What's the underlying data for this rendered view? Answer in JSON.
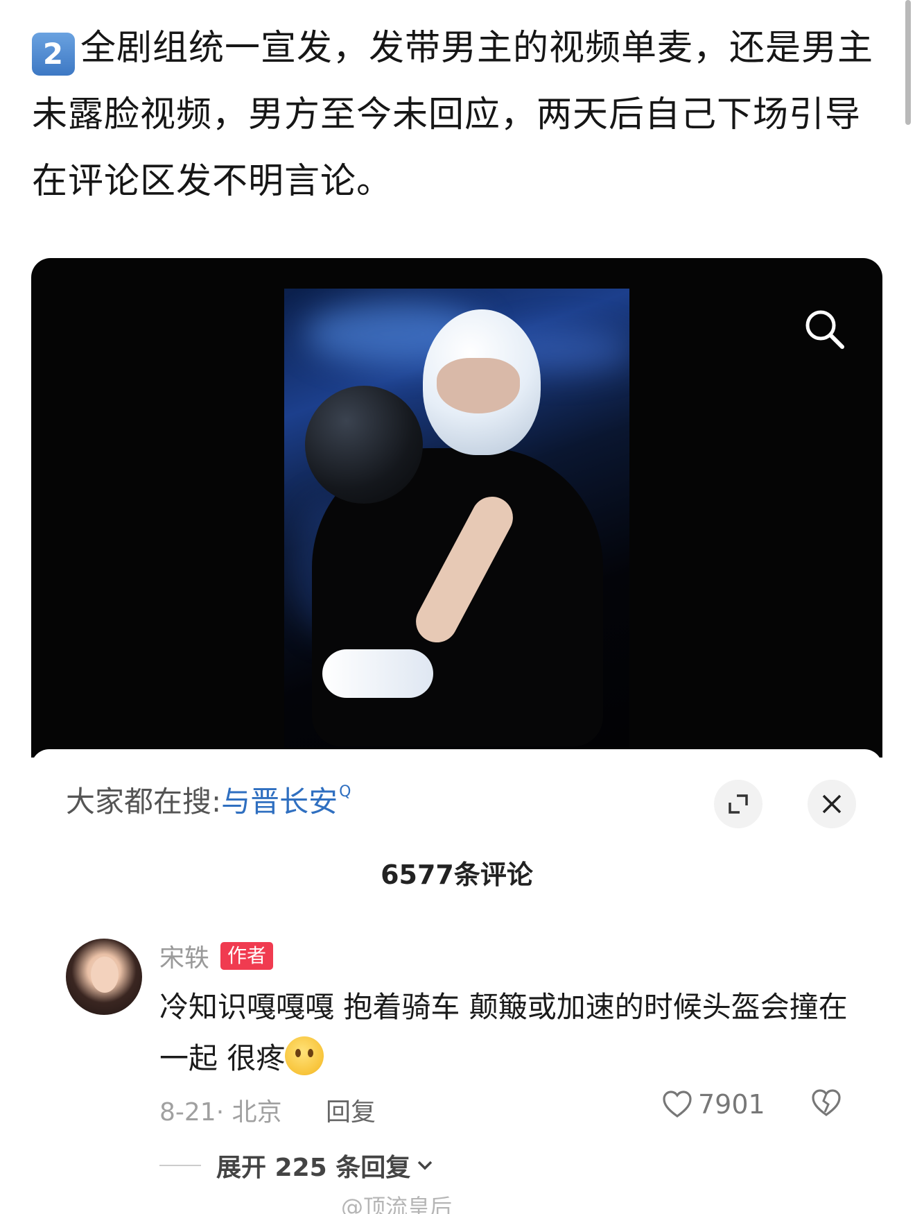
{
  "post": {
    "badge": "2",
    "text": "全剧组统一宣发，发带男主的视频单麦，还是男主未露脸视频，男方至今未回应，两天后自己下场引导在评论区发不明言论。"
  },
  "panel": {
    "search_prefix": "大家都在搜:",
    "search_term": "与晋长安",
    "search_icon": "Q",
    "comment_count_label": "6577条评论"
  },
  "comment": {
    "user_name": "宋轶",
    "author_badge": "作者",
    "text": "冷知识嘎嘎嘎 抱着骑车 颠簸或加速的时候头盔会撞在一起 很疼",
    "emoji": "crying-face-emoji",
    "date_location": "8-21· 北京",
    "reply_label": "回复",
    "like_count": "7901",
    "expand_replies_label": "展开 225 条回复"
  },
  "watermark": "@顶流皇后",
  "icons": {
    "search": "search-icon",
    "expand": "expand-icon",
    "close": "close-icon",
    "like": "heart-icon",
    "dislike": "broken-heart-icon",
    "chevron": "chevron-down-icon"
  },
  "colors": {
    "link_blue": "#2f6fc0",
    "author_badge": "#f03b50"
  }
}
